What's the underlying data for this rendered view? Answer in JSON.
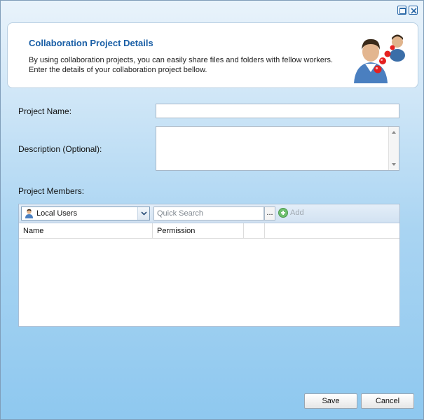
{
  "window": {
    "restore_icon": "restore-icon",
    "close_icon": "close-icon"
  },
  "header": {
    "title": "Collaboration Project Details",
    "description_line1": "By using collaboration projects, you can easily share files and folders with fellow workers.",
    "description_line2": "Enter the details of your collaboration project bellow.",
    "graphic": "collaboration-users-icon"
  },
  "form": {
    "project_name_label": "Project Name:",
    "project_name_value": "",
    "description_label": "Description (Optional):",
    "description_value": "",
    "members_label": "Project Members:"
  },
  "members": {
    "source_selected": "Local Users",
    "search_placeholder": "Quick Search",
    "browse_label": "...",
    "add_label": "Add",
    "columns": [
      "Name",
      "Permission",
      ""
    ],
    "rows": []
  },
  "buttons": {
    "save": "Save",
    "cancel": "Cancel"
  },
  "colors": {
    "title": "#1a5fa6",
    "background": "#8ec8ef"
  }
}
